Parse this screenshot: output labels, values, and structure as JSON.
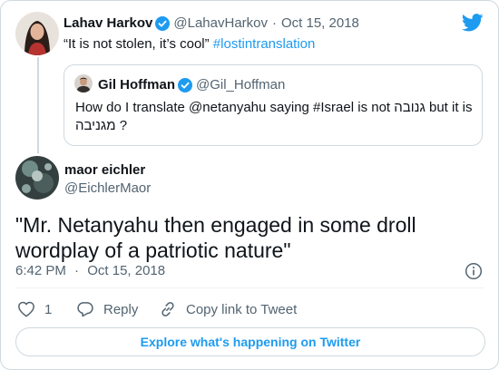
{
  "colors": {
    "accent": "#1d9bf0",
    "text": "#0f1419",
    "secondary": "#536471",
    "border": "#cfd9de"
  },
  "parent_tweet": {
    "name": "Lahav Harkov",
    "handle": "@LahavHarkov",
    "separator": "·",
    "date": "Oct 15, 2018",
    "text_prefix": "“It is not stolen, it’s cool” ",
    "hashtag": "#lostintranslation",
    "verified_icon": "verified-badge-icon"
  },
  "quoted_tweet": {
    "name": "Gil Hoffman",
    "handle": "@Gil_Hoffman",
    "text": "How do I translate @netanyahu saying #Israel is not גנובה but it is מגניבה ?",
    "verified_icon": "verified-badge-icon"
  },
  "main_tweet": {
    "name": "maor eichler",
    "handle": "@EichlerMaor",
    "text": "\"Mr. Netanyahu then engaged in some droll wordplay of a patriotic nature\"",
    "time": "6:42 PM",
    "separator": "·",
    "date": "Oct 15, 2018"
  },
  "actions": {
    "like_count": "1",
    "reply_label": "Reply",
    "copy_label": "Copy link to Tweet"
  },
  "footer": {
    "explore_label": "Explore what's happening on Twitter"
  },
  "icons": [
    "twitter-bird-icon",
    "verified-badge-icon",
    "info-icon",
    "heart-icon",
    "reply-icon",
    "link-icon"
  ]
}
